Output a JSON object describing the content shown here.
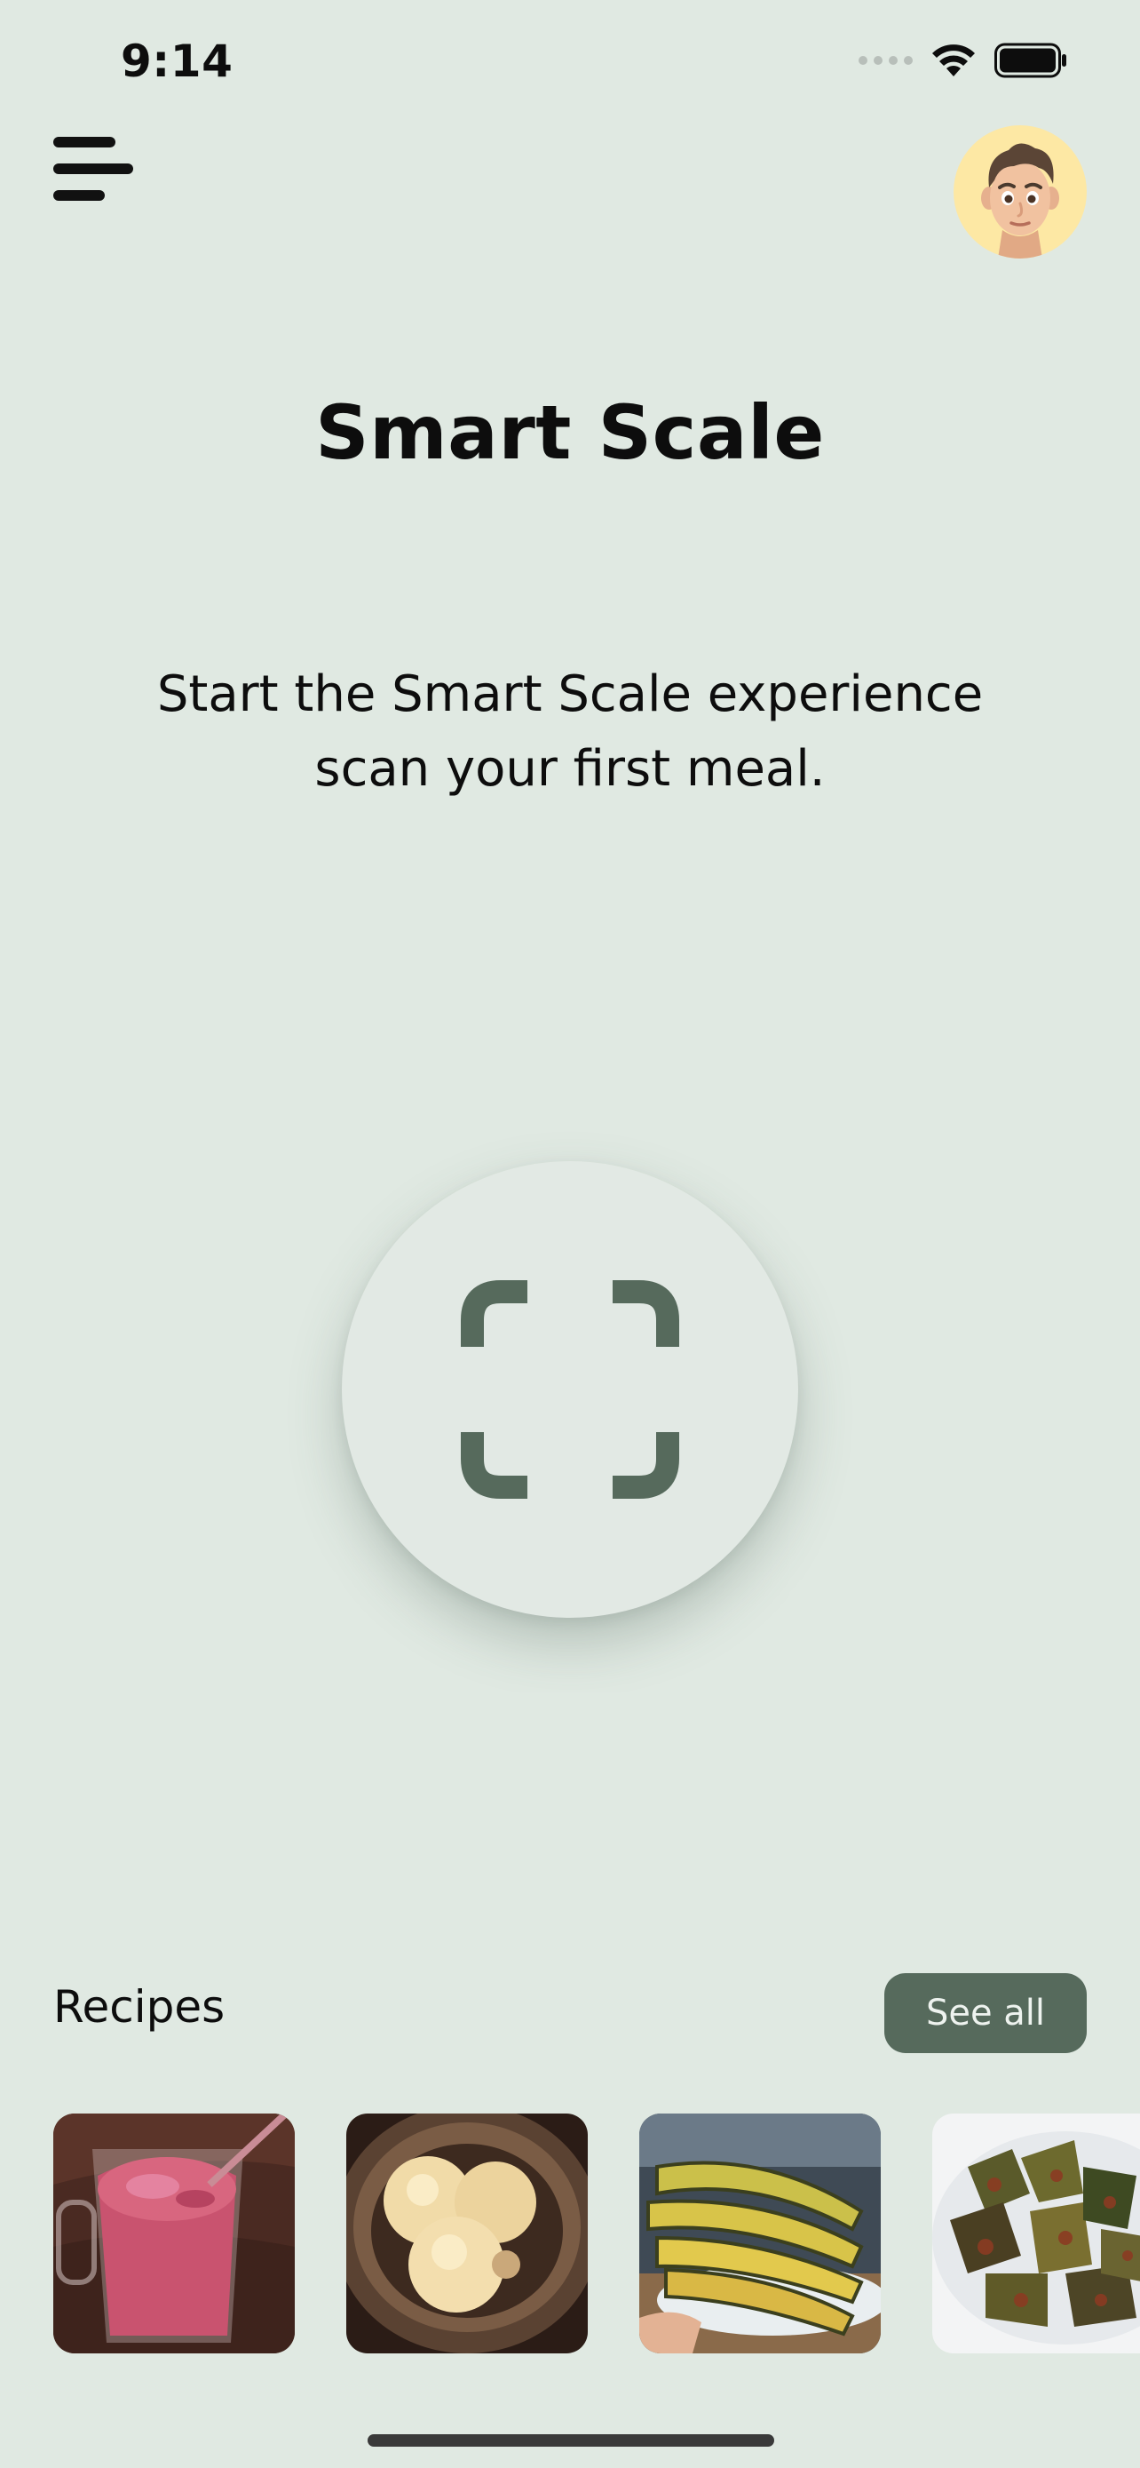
{
  "status_bar": {
    "time": "9:14",
    "icons": [
      "cellular-dots-icon",
      "wifi-icon",
      "battery-icon"
    ]
  },
  "header": {
    "menu_icon": "hamburger-menu-icon",
    "avatar_icon": "memoji-avatar"
  },
  "main": {
    "title": "Smart Scale",
    "subtitle_line1": "Start the Smart Scale experience",
    "subtitle_line2": "scan your first meal.",
    "scan_icon": "scan-frame-icon"
  },
  "recipes": {
    "heading": "Recipes",
    "see_all_label": "See all",
    "items": [
      {
        "image": "berry-smoothie"
      },
      {
        "image": "ice-cream-bowl"
      },
      {
        "image": "grilled-corn"
      },
      {
        "image": "fried-artichokes"
      }
    ]
  },
  "colors": {
    "background": "#e0e9e2",
    "accent": "#566a5c",
    "avatar_bg": "#fde8a4",
    "text": "#0d0d0d"
  }
}
